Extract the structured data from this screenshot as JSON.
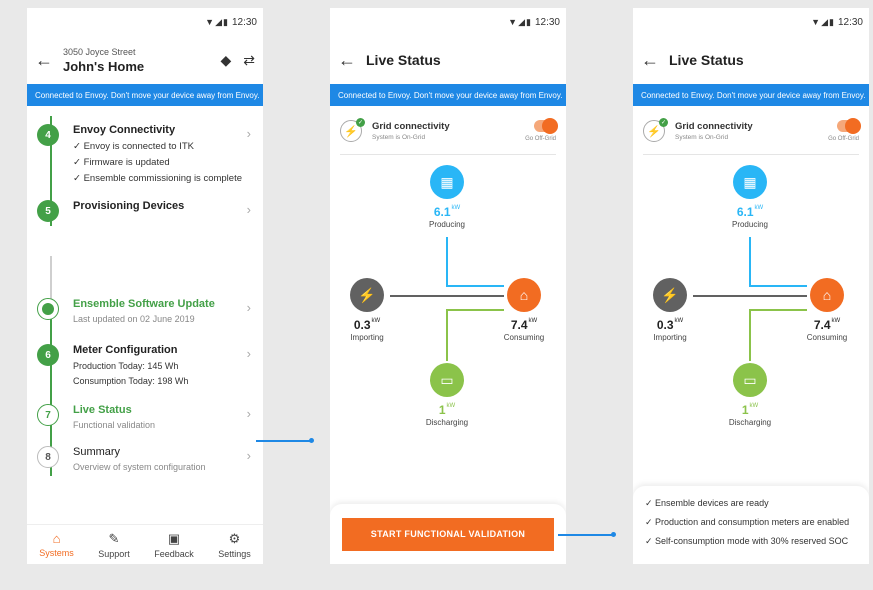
{
  "statusbar": {
    "time": "12:30",
    "icons": "▼◢▮"
  },
  "banner_text": "Connected to Envoy. Don't move your device away from Envoy.",
  "phone1": {
    "address": "3050 Joyce Street",
    "home_name": "John's Home",
    "steps": [
      {
        "num": "4",
        "title": "Envoy Connectivity",
        "checks": [
          "✓ Envoy is connected to ITK",
          "✓ Firmware is updated",
          "✓ Ensemble commissioning is complete"
        ]
      },
      {
        "num": "5",
        "title": "Provisioning Devices"
      },
      {
        "title": "Ensemble Software Update",
        "sub": "Last updated on 02 June 2019"
      },
      {
        "num": "6",
        "title": "Meter Configuration",
        "details": [
          "Production Today: 145 Wh",
          "Consumption Today: 198 Wh"
        ]
      },
      {
        "num": "7",
        "title": "Live Status",
        "sub": "Functional validation"
      },
      {
        "num": "8",
        "title": "Summary",
        "sub": "Overview of system configuration"
      }
    ],
    "tabs": [
      {
        "label": "Systems",
        "icon": "home-icon"
      },
      {
        "label": "Support",
        "icon": "wrench-icon"
      },
      {
        "label": "Feedback",
        "icon": "feedback-icon"
      },
      {
        "label": "Settings",
        "icon": "gear-icon"
      }
    ]
  },
  "live": {
    "title": "Live Status",
    "grid_title": "Grid connectivity",
    "grid_sub": "System is On-Grid",
    "toggle_label": "Go Off-Grid",
    "producing_value": "6.1",
    "producing_unit": "kW",
    "producing_label": "Producing",
    "importing_value": "0.3",
    "importing_unit": "kW",
    "importing_label": "Importing",
    "consuming_value": "7.4",
    "consuming_unit": "kW",
    "consuming_label": "Consuming",
    "discharging_value": "1",
    "discharging_unit": "kW",
    "discharging_label": "Discharging",
    "cta_label": "START FUNCTIONAL VALIDATION"
  },
  "results": [
    "✓  Ensemble devices are ready",
    "✓  Production and consumption meters are enabled",
    "✓  Self-consumption mode with 30% reserved SOC"
  ],
  "colors": {
    "accent": "#f26c22",
    "green": "#43a047",
    "blue": "#1e88e5",
    "solar": "#29b6f6",
    "battery": "#8bc34a",
    "grid": "#616161"
  }
}
